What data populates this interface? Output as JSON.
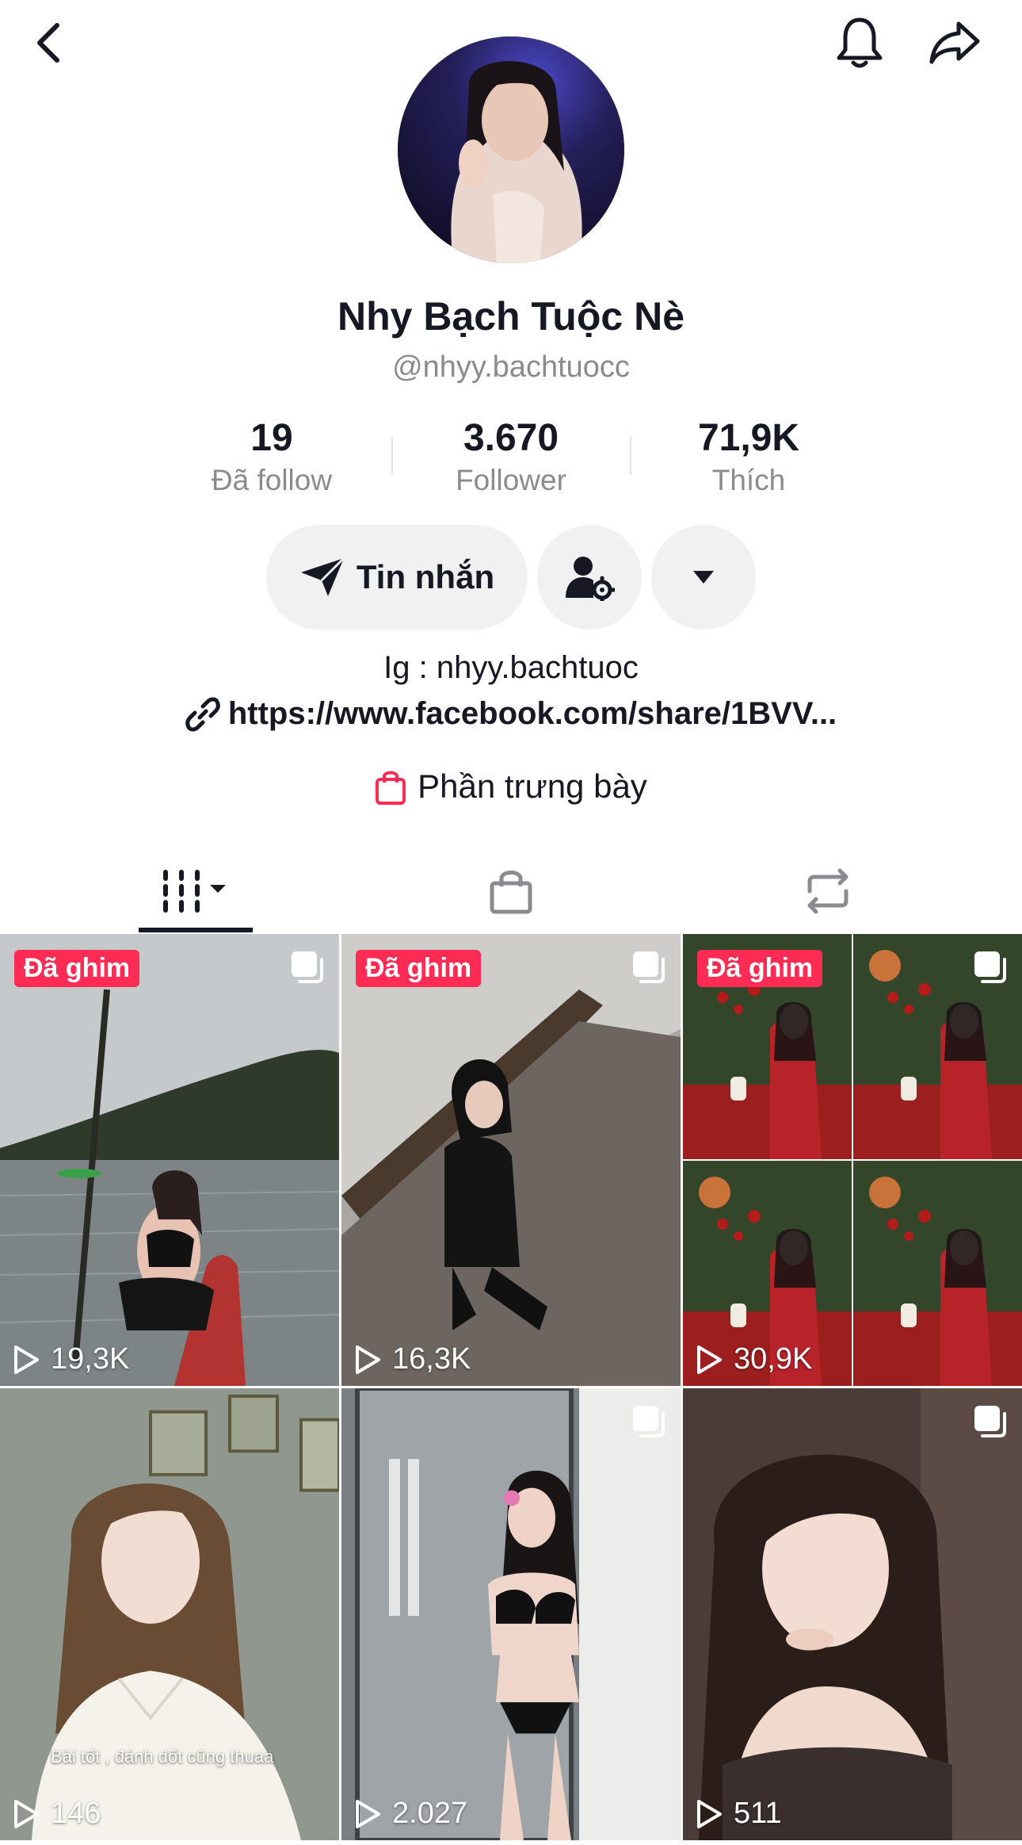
{
  "header": {
    "back_icon": "chevron-left-icon",
    "bell_icon": "bell-icon",
    "share_icon": "share-arrow-icon"
  },
  "profile": {
    "display_name": "Nhy Bạch Tuộc Nè",
    "username": "@nhyy.bachtuocc"
  },
  "stats": [
    {
      "value": "19",
      "label": "Đã follow"
    },
    {
      "value": "3.670",
      "label": "Follower"
    },
    {
      "value": "71,9K",
      "label": "Thích"
    }
  ],
  "actions": {
    "message_label": "Tin nhắn",
    "message_icon": "send-icon",
    "friend_settings_icon": "user-settings-icon",
    "more_icon": "caret-down-icon"
  },
  "bio": {
    "text": "Ig : nhyy.bachtuoc",
    "link": "https://www.facebook.com/share/1BVV..."
  },
  "showcase": {
    "label": "Phần trưng bày",
    "accent": "#fe2c55"
  },
  "tabs": [
    {
      "name": "videos",
      "icon": "grid-icon"
    },
    {
      "name": "shop",
      "icon": "shopping-bag-icon"
    },
    {
      "name": "reposts",
      "icon": "repost-icon"
    }
  ],
  "videos": [
    {
      "pinned_label": "Đã ghim",
      "views": "19,3K",
      "multi": true
    },
    {
      "pinned_label": "Đã ghim",
      "views": "16,3K",
      "multi": true
    },
    {
      "pinned_label": "Đã ghim",
      "views": "30,9K",
      "multi": true
    },
    {
      "views": "146",
      "multi": false,
      "caption": "Bài tốt , đánh dốt cũng thuaa"
    },
    {
      "views": "2.027",
      "multi": true
    },
    {
      "views": "511",
      "multi": true
    }
  ],
  "colors": {
    "pin_badge": "#fe2c55",
    "muted_text": "#8a8b91",
    "button_bg": "#f1f1f2"
  }
}
